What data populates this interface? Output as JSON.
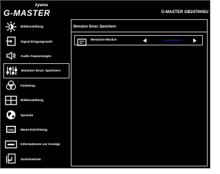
{
  "header": {
    "brand_small": "iiyama",
    "brand_main": "G-MASTER",
    "model": "G-MASTER GB2470HSU"
  },
  "sidebar": {
    "items": [
      {
        "label": "Bildeinstellung",
        "icon": "brightness-icon"
      },
      {
        "label": "Signal Eingangswahl",
        "icon": "input-icon"
      },
      {
        "label": "Audio Anpassungen",
        "icon": "speaker-icon"
      },
      {
        "label": "Benutzer Einst. Speichern",
        "icon": "sliders-icon",
        "active": true
      },
      {
        "label": "Farbtemp.",
        "icon": "color-circles-icon"
      },
      {
        "label": "Bildeinstellung",
        "icon": "picture-icon"
      },
      {
        "label": "Sprache",
        "icon": "globe-icon"
      },
      {
        "label": "Menü Einrichtung",
        "icon": "osd-icon"
      },
      {
        "label": "Informationen zur Anzeige",
        "icon": "info-monitor-icon"
      },
      {
        "label": "Zurücksetzen",
        "icon": "reset-icon"
      }
    ]
  },
  "panel": {
    "header": "Benutzer Einst. Speichern",
    "setting": {
      "label": "Benutzer-Modus",
      "value": "User Mode 1",
      "icon": "user-mode-icon"
    }
  },
  "colors": {
    "background": "#000000",
    "text": "#ffffff",
    "border": "#c8c8c8",
    "value_highlight": "#1e2a9c"
  }
}
